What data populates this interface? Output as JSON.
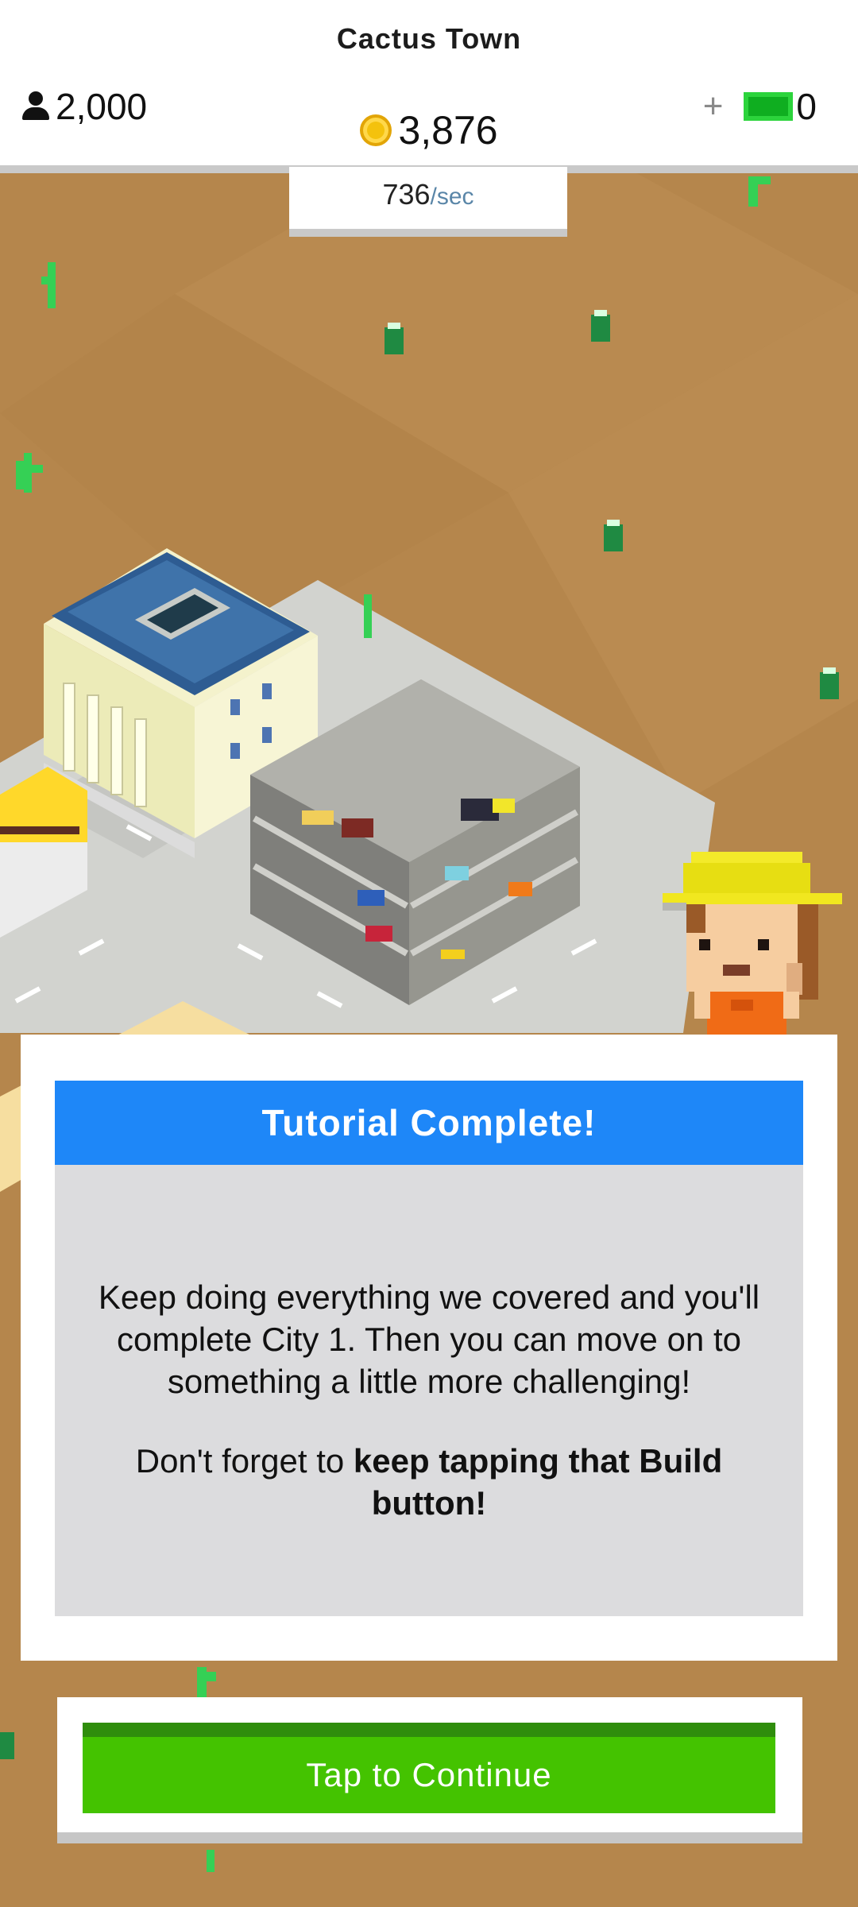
{
  "hud": {
    "city_name": "Cactus Town",
    "population": "2,000",
    "coins": "3,876",
    "rate_value": "736",
    "rate_unit": "/sec",
    "cash_plus": "+",
    "cash": "0"
  },
  "dialog": {
    "title": "Tutorial Complete!",
    "paragraph_1": "Keep doing everything we covered and you'll complete City 1. Then you can move on to something a little more challenging!",
    "paragraph_2_plain": "Don't forget to ",
    "paragraph_2_bold": "keep tapping that Build button!"
  },
  "continue_button": {
    "label": "Tap to Continue"
  },
  "colors": {
    "ground": "#b5864c",
    "header_blue": "#1e87f8",
    "continue_green": "#44c300",
    "dialog_body": "#dcdcde"
  },
  "icons": [
    "person-icon",
    "coin-icon",
    "cash-icon",
    "cactus-icon",
    "barrel-icon"
  ]
}
